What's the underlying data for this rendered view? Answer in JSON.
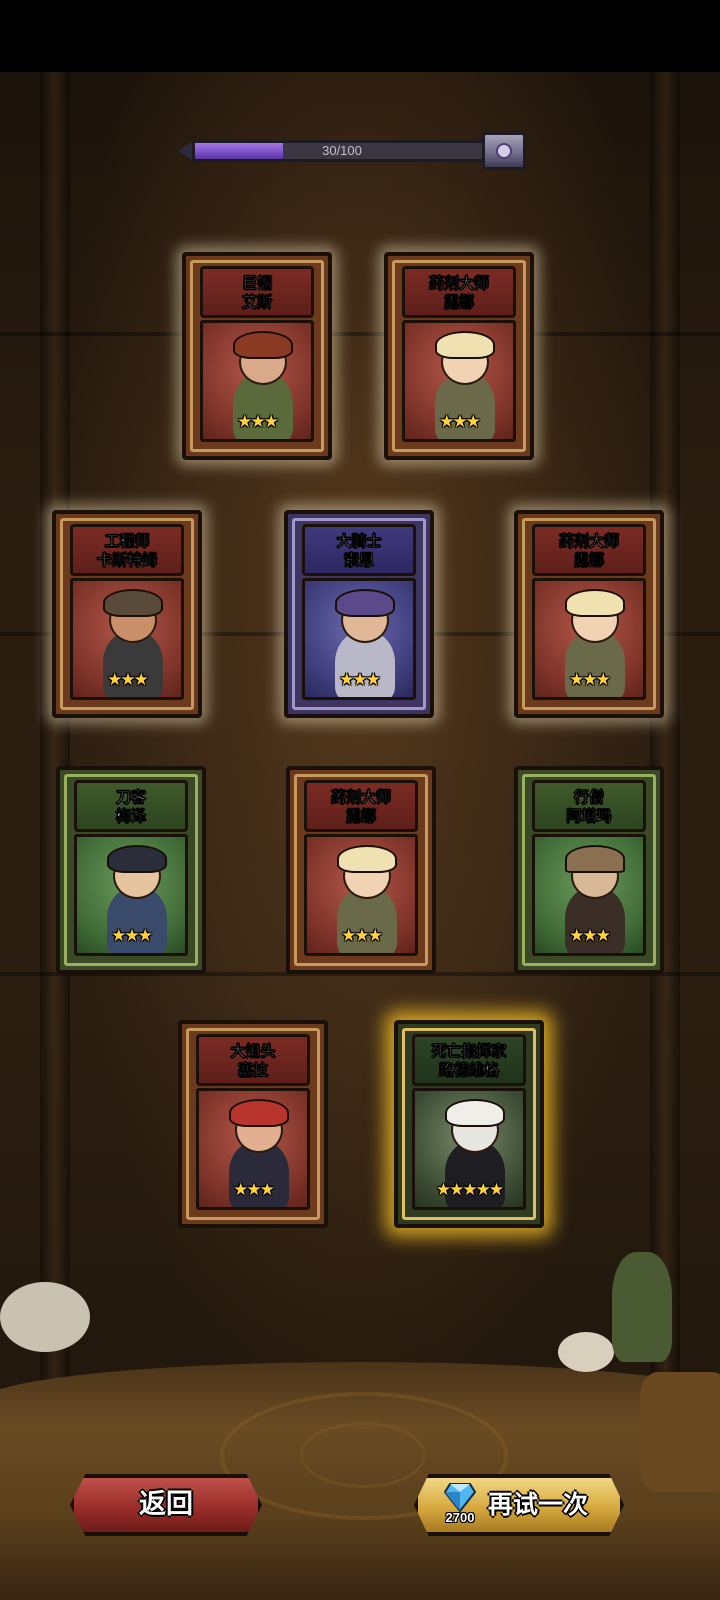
{
  "progress": {
    "text": "30/100",
    "value": 30,
    "max": 100,
    "fill_color": "#7a4ec6"
  },
  "heroes": [
    {
      "title": "巨锯",
      "name": "艾斯",
      "stars": "★★★",
      "star_count": 3,
      "rarity": "red",
      "glow": "white"
    },
    {
      "title": "药剂大师",
      "name": "露娜",
      "stars": "★★★",
      "star_count": 3,
      "rarity": "red",
      "glow": "white"
    },
    {
      "title": "工程师",
      "name": "卡斯特姆",
      "stars": "★★★",
      "star_count": 3,
      "rarity": "red",
      "glow": "white"
    },
    {
      "title": "大骑士",
      "name": "索恩",
      "stars": "★★★",
      "star_count": 3,
      "rarity": "blue",
      "glow": "white"
    },
    {
      "title": "药剂大师",
      "name": "露娜",
      "stars": "★★★",
      "star_count": 3,
      "rarity": "red",
      "glow": "white"
    },
    {
      "title": "刀客",
      "name": "梅泽",
      "stars": "★★★",
      "star_count": 3,
      "rarity": "green",
      "glow": "none"
    },
    {
      "title": "药剂大师",
      "name": "露娜",
      "stars": "★★★",
      "star_count": 3,
      "rarity": "red",
      "glow": "none"
    },
    {
      "title": "行僧",
      "name": "阿塔玛",
      "stars": "★★★",
      "star_count": 3,
      "rarity": "green",
      "glow": "none"
    },
    {
      "title": "大姐头",
      "name": "塞拉",
      "stars": "★★★",
      "star_count": 3,
      "rarity": "red",
      "glow": "none"
    },
    {
      "title": "死亡指挥家",
      "name": "路德维格",
      "stars": "★★★★★",
      "star_count": 5,
      "rarity": "legend",
      "glow": "gold"
    }
  ],
  "buttons": {
    "back_label": "返回",
    "retry_label": "再试一次",
    "retry_cost": "2700",
    "cost_icon": "diamond-icon"
  },
  "colors": {
    "accent_gold": "#ffd23a",
    "back_button": "#9a2e2a",
    "retry_button": "#d6a93e"
  }
}
